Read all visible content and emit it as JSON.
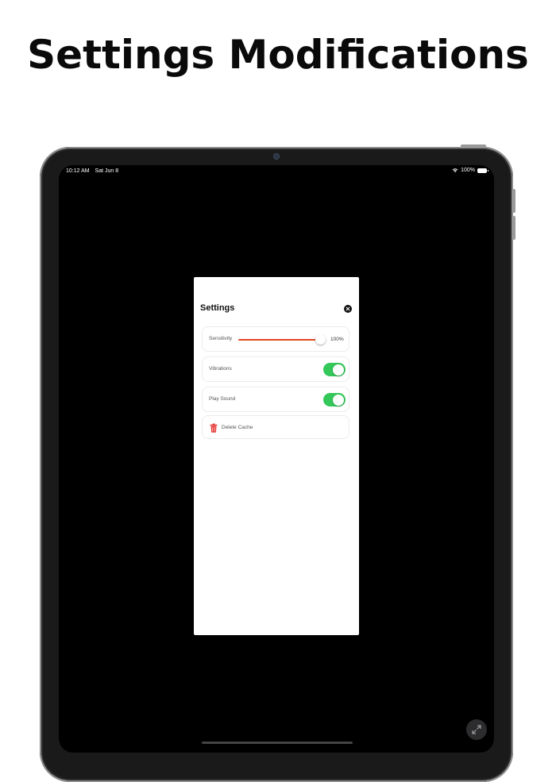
{
  "headline": "Settings Modifications",
  "status_bar": {
    "time": "10:12 AM",
    "date": "Sat Jun 8",
    "battery": "100%"
  },
  "settings": {
    "title": "Settings",
    "sensitivity": {
      "label": "Sensitivity",
      "value_label": "100%",
      "value": 1.0,
      "track_color": "#e04a24"
    },
    "vibrations": {
      "label": "Vibrations",
      "on": true
    },
    "play_sound": {
      "label": "Play Sound",
      "on": true
    },
    "delete_cache": {
      "label": "Delete Cache",
      "icon": "trash-icon",
      "icon_color": "#e53935"
    },
    "toggle_color": "#34c759"
  },
  "icons": {
    "close": "close-icon",
    "expand": "expand-icon",
    "wifi": "wifi-icon",
    "battery": "battery-icon"
  }
}
